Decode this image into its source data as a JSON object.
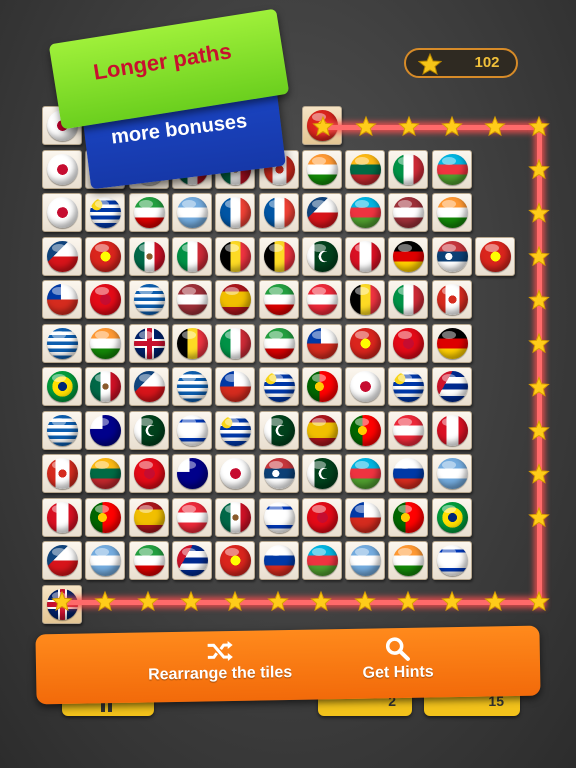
{
  "score": {
    "value": "102"
  },
  "banners": {
    "line1": "Longer paths",
    "line2": "more bonuses"
  },
  "flags": {
    "kr": [
      "#ffffff",
      "#ffffff",
      "#ffffff",
      "#c60c30",
      "#003478"
    ],
    "ca": [
      "#d52b1e",
      "#ffffff",
      "#d52b1e",
      "#d52b1e",
      "#ffffff"
    ],
    "in": [
      "#ff9933",
      "#ffffff",
      "#138808",
      "#000080",
      "#000080"
    ],
    "lt": [
      "#fdb913",
      "#006a44",
      "#c1272d",
      "",
      ""
    ],
    "it": [
      "#009246",
      "#ffffff",
      "#ce2b37",
      "",
      ""
    ],
    "az": [
      "#00b5e2",
      "#ef3340",
      "#509e2f",
      "#ffffff",
      "#ffffff"
    ],
    "uy": [
      "#ffffff",
      "#0038a8",
      "#ffffff",
      "#f9d616",
      "#0038a8"
    ],
    "ir": [
      "#239f40",
      "#ffffff",
      "#da0000",
      "#da0000",
      "#ffffff"
    ],
    "ar": [
      "#74acdf",
      "#ffffff",
      "#74acdf",
      "#f6b40e",
      "#ffffff"
    ],
    "fr": [
      "#0055a4",
      "#ffffff",
      "#ef4135",
      "",
      ""
    ],
    "cz": [
      "#ffffff",
      "#d7141a",
      "#11457e",
      "",
      ""
    ],
    "lv": [
      "#9e3039",
      "#ffffff",
      "#9e3039",
      "",
      ""
    ],
    "vn": [
      "#da251d",
      "#ffff00",
      "",
      "",
      ""
    ],
    "mx": [
      "#006847",
      "#ffffff",
      "#ce1126",
      "#8a5a2b",
      ""
    ],
    "ro": [
      "#002b7f",
      "#fcd116",
      "#ce1126",
      "",
      ""
    ],
    "be": [
      "#000000",
      "#fdda24",
      "#ef3340",
      "",
      ""
    ],
    "pk": [
      "#01411c",
      "#ffffff",
      "#ffffff",
      "",
      ""
    ],
    "at": [
      "#ed2939",
      "#ffffff",
      "#ed2939",
      "",
      ""
    ],
    "de": [
      "#000000",
      "#dd0000",
      "#ffce00",
      "",
      ""
    ],
    "rs": [
      "#c6363c",
      "#0c4076",
      "#ffffff",
      "#c6363c",
      ""
    ],
    "cl": [
      "#ffffff",
      "#d52b1e",
      "#0039a6",
      "#ffffff",
      ""
    ],
    "pe": [
      "#d91023",
      "#ffffff",
      "#d91023",
      "",
      ""
    ],
    "gr": [
      "#0d5eaf",
      "#ffffff",
      "",
      ""
    ],
    "gb": [
      "#012169",
      "#ffffff",
      "#c8102e",
      "",
      ""
    ],
    "br": [
      "#009c3b",
      "#ffdf00",
      "#002776",
      "",
      ""
    ],
    "cu": [
      "#002a8f",
      "#ffffff",
      "#cf142b",
      "",
      ""
    ],
    "il": [
      "#ffffff",
      "#0038b8",
      "",
      ""
    ],
    "au": [
      "#00008b",
      "#ffffff",
      "#ff0000",
      "",
      ""
    ],
    "es": [
      "#aa151b",
      "#f1bf00",
      "#aa151b",
      "",
      ""
    ],
    "pt": [
      "#006600",
      "#ff0000",
      "#ffcc00",
      "",
      ""
    ],
    "ru": [
      "#ffffff",
      "#0039a6",
      "#d52b1e",
      "",
      ""
    ],
    "jp": [
      "#ffffff",
      "#bc002d",
      "",
      ""
    ],
    "tr": [
      "#e30a17",
      "#ffffff",
      "",
      ""
    ]
  },
  "board": {
    "rows": [
      [
        "jp",
        null,
        null,
        null,
        null,
        null,
        null,
        "vn",
        null,
        null,
        null,
        null,
        null
      ],
      [
        "kr",
        "ir",
        "jp",
        "mx",
        "mx",
        "ca",
        "in",
        "lt",
        "it",
        "az"
      ],
      [
        "kr",
        "uy",
        "ir",
        "ar",
        "fr",
        "fr",
        "cz",
        "az",
        "lv",
        "in"
      ],
      [
        "cz",
        "vn",
        "mx",
        "it",
        "be",
        "be",
        "pk",
        "pe",
        "de",
        "rs",
        "vn"
      ],
      [
        "cl",
        "tr",
        "gr",
        "lv",
        "es",
        "ir",
        "at",
        "be",
        "it",
        "ca"
      ],
      [
        "gr",
        "in",
        "gb",
        "be",
        "it",
        "ir",
        "cl",
        "vn",
        "tr",
        "de"
      ],
      [
        "br",
        "mx",
        "cz",
        "gr",
        "cl",
        "uy",
        "pt",
        "kr",
        "uy",
        "cu"
      ],
      [
        "gr",
        "au",
        "pk",
        "il",
        "uy",
        "pk",
        "es",
        "pt",
        "at",
        "pe"
      ],
      [
        "ca",
        "lt",
        "tr",
        "au",
        "kr",
        "rs",
        "pk",
        "az",
        "ru",
        "ar"
      ],
      [
        "pe",
        "pt",
        "es",
        "at",
        "mx",
        "il",
        "tr",
        "cl",
        "pt",
        "br"
      ],
      [
        "cz",
        "ar",
        "ir",
        "cu",
        "vn",
        "ru",
        "az",
        "ar",
        "in",
        "il"
      ],
      [
        "gb"
      ]
    ]
  },
  "bottom": {
    "rearrange_label": "Rearrange the tiles",
    "hints_label": "Get Hints",
    "shuffle_count": "2",
    "hint_count": "15"
  }
}
